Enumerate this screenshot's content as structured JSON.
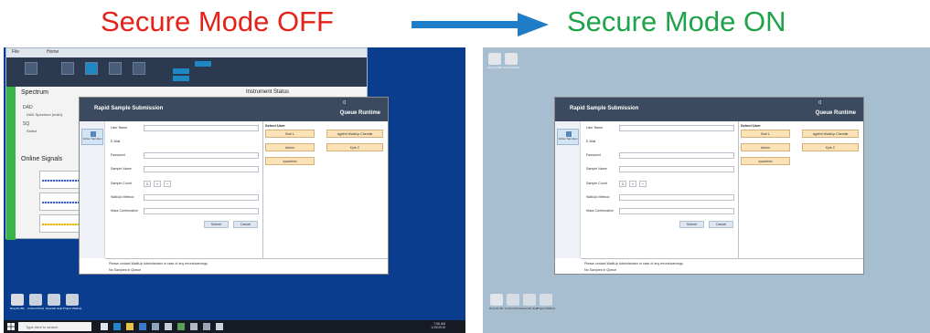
{
  "headings": {
    "off": "Secure Mode OFF",
    "on": "Secure Mode ON"
  },
  "colors": {
    "off_text": "#e32219",
    "on_text": "#1fa34a",
    "arrow": "#1f7cc6",
    "desktop_standard": "#0b3d8f",
    "desktop_secure": "#a7bdd0",
    "rss_header": "#3b4a5e",
    "user_button": "#fbe3b7"
  },
  "left_panel": {
    "app": {
      "ribbon_tabs": [
        "File",
        "Home"
      ],
      "spectrum_title": "Spectrum",
      "dad_label": "DAD",
      "dad_sub": "DAD Spectrum (mAU)",
      "sq_label": "SQ",
      "sq_sub": "Select",
      "online_title": "Online Signals",
      "instrument_status": "Instrument Status"
    },
    "taskbar": {
      "search_placeholder": "Type here to search",
      "time": "7:56 AM",
      "date": "1/19/2019"
    },
    "desktop_icons": [
      "Recycle Bin",
      "Control Panel",
      "Openlab Help",
      "Project WalkUp"
    ]
  },
  "right_panel": {
    "desktop_icons": [
      "Recycle Bin",
      "Control Panel",
      "Openlab Help",
      "Project WalkUp"
    ]
  },
  "rss": {
    "title": "Rapid Sample Submission",
    "queue_count": "0",
    "queue_label": "Queue Runtime",
    "nav_button": "Active Samples",
    "fields": [
      "User Name",
      "E-Mail",
      "Password",
      "Sample Name",
      "Sample Count",
      "WalkUp Method",
      "Mass Confirmation"
    ],
    "sample_count_value": "1",
    "stepper_plus": "+",
    "stepper_minus": "−",
    "submit": "Submit",
    "cancel": "Cancel",
    "select_user_heading": "Select User",
    "users": [
      "Bob L",
      "Agilent WalkUp Chemist",
      "Admin",
      "Kyle C",
      "sysadmin"
    ],
    "footer_note": "Please contact WalkUp Administrator in case of any errors/warnings",
    "footer_status": "No Samples in Queue"
  }
}
